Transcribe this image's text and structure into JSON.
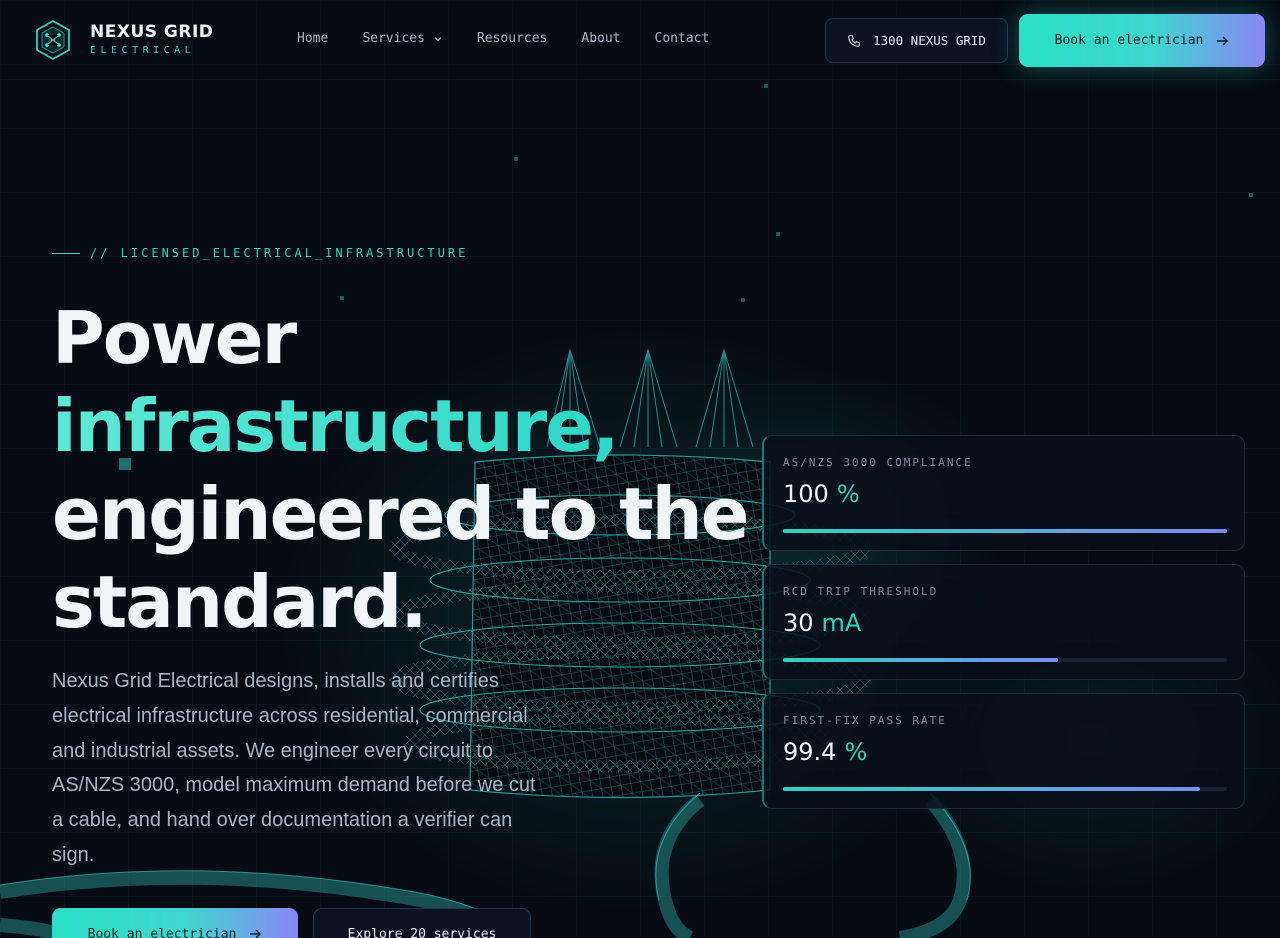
{
  "brand": {
    "name": "NEXUS GRID",
    "sub": "ELECTRICAL",
    "accent": "#2dd4bf"
  },
  "nav": {
    "home": "Home",
    "services": "Services",
    "resources": "Resources",
    "about": "About",
    "contact": "Contact"
  },
  "header": {
    "phone": "1300 NEXUS GRID",
    "book": "Book an electrician"
  },
  "hero": {
    "eyebrow": "// LICENSED_ELECTRICAL_INFRASTRUCTURE",
    "line1": "Power",
    "line2": "infrastructure,",
    "line3": "engineered to the",
    "line4": "standard.",
    "lead": "Nexus Grid Electrical designs, installs and certifies electrical infrastructure across residential, commercial and industrial assets. We engineer every circuit to AS/NZS 3000, model maximum demand before we cut a cable, and hand over documentation a verifier can sign.",
    "cta_primary": "Book an electrician",
    "cta_secondary": "Explore 20 services"
  },
  "stats": [
    {
      "label": "AS/NZS 3000 COMPLIANCE",
      "value": "100",
      "unit": "%",
      "progress": 1.0
    },
    {
      "label": "RCD TRIP THRESHOLD",
      "value": "30",
      "unit": "mA",
      "progress": 0.62
    },
    {
      "label": "FIRST-FIX PASS RATE",
      "value": "99.4",
      "unit": "%",
      "progress": 0.94
    }
  ]
}
